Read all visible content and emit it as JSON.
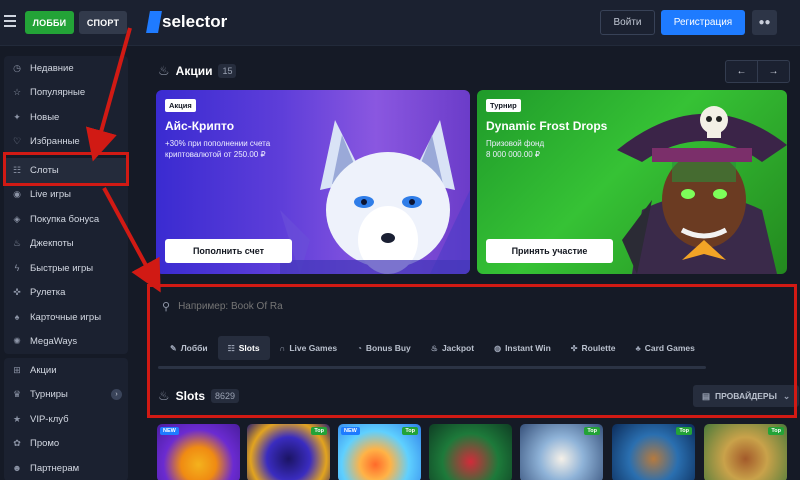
{
  "topbar": {
    "lobby_label": "ЛОББИ",
    "sport_label": "СПОРТ",
    "logo_text": "selector",
    "login_label": "Войти",
    "register_label": "Регистрация"
  },
  "sidebar": {
    "group1": [
      {
        "label": "Недавние",
        "icon": "clock-icon"
      },
      {
        "label": "Популярные",
        "icon": "star-icon"
      },
      {
        "label": "Новые",
        "icon": "sparkle-icon"
      },
      {
        "label": "Избранные",
        "icon": "heart-icon"
      }
    ],
    "group2": [
      {
        "label": "Слоты",
        "icon": "slots-icon",
        "active": true
      },
      {
        "label": "Live игры",
        "icon": "live-icon"
      },
      {
        "label": "Покупка бонуса",
        "icon": "cart-icon"
      },
      {
        "label": "Джекпоты",
        "icon": "flame-icon"
      },
      {
        "label": "Быстрые игры",
        "icon": "lightning-icon"
      },
      {
        "label": "Рулетка",
        "icon": "roulette-icon"
      },
      {
        "label": "Карточные игры",
        "icon": "cards-icon"
      },
      {
        "label": "MegaWays",
        "icon": "megaways-icon"
      }
    ],
    "group3": [
      {
        "label": "Акции",
        "icon": "gift-icon"
      },
      {
        "label": "Турниры",
        "icon": "trophy-icon"
      },
      {
        "label": "VIP-клуб",
        "icon": "vip-icon"
      },
      {
        "label": "Промо",
        "icon": "promo-icon"
      },
      {
        "label": "Партнерам",
        "icon": "partners-icon"
      }
    ]
  },
  "promos": {
    "title": "Акции",
    "count": "15",
    "banners": [
      {
        "tag": "Акция",
        "title": "Айс-Крипто",
        "sub": "+30% при пополнении счета криптовалютой от 250.00 ₽",
        "button": "Пополнить счет"
      },
      {
        "tag": "Турнир",
        "title": "Dynamic Frost Drops",
        "sub": "Призовой фонд\n8 000 000.00 ₽",
        "button": "Принять участие"
      }
    ]
  },
  "search": {
    "placeholder": "Например: Book Of Ra"
  },
  "tabs": [
    {
      "label": "Лобби",
      "icon": "lobby-icon"
    },
    {
      "label": "Slots",
      "icon": "slots-icon",
      "active": true
    },
    {
      "label": "Live Games",
      "icon": "headset-icon"
    },
    {
      "label": "Bonus Buy",
      "icon": "bonus-icon"
    },
    {
      "label": "Jackpot",
      "icon": "flame-icon"
    },
    {
      "label": "Instant Win",
      "icon": "flash-icon"
    },
    {
      "label": "Roulette",
      "icon": "roulette-icon"
    },
    {
      "label": "Card Games",
      "icon": "cards-icon"
    }
  ],
  "slots": {
    "title": "Slots",
    "count": "8629",
    "providers_label": "ПРОВАЙДЕРЫ"
  },
  "tiles": [
    {
      "badge_new": "NEW",
      "badge_top": ""
    },
    {
      "badge_new": "",
      "badge_top": "Top"
    },
    {
      "badge_new": "NEW",
      "badge_top": "Top"
    },
    {
      "badge_new": "",
      "badge_top": ""
    },
    {
      "badge_new": "",
      "badge_top": "Top"
    },
    {
      "badge_new": "",
      "badge_top": "Top"
    },
    {
      "badge_new": "",
      "badge_top": "Top"
    }
  ],
  "colors": {
    "accent": "#1e7bff",
    "lobby_green": "#23a337",
    "annotation_red": "#d11a14"
  }
}
